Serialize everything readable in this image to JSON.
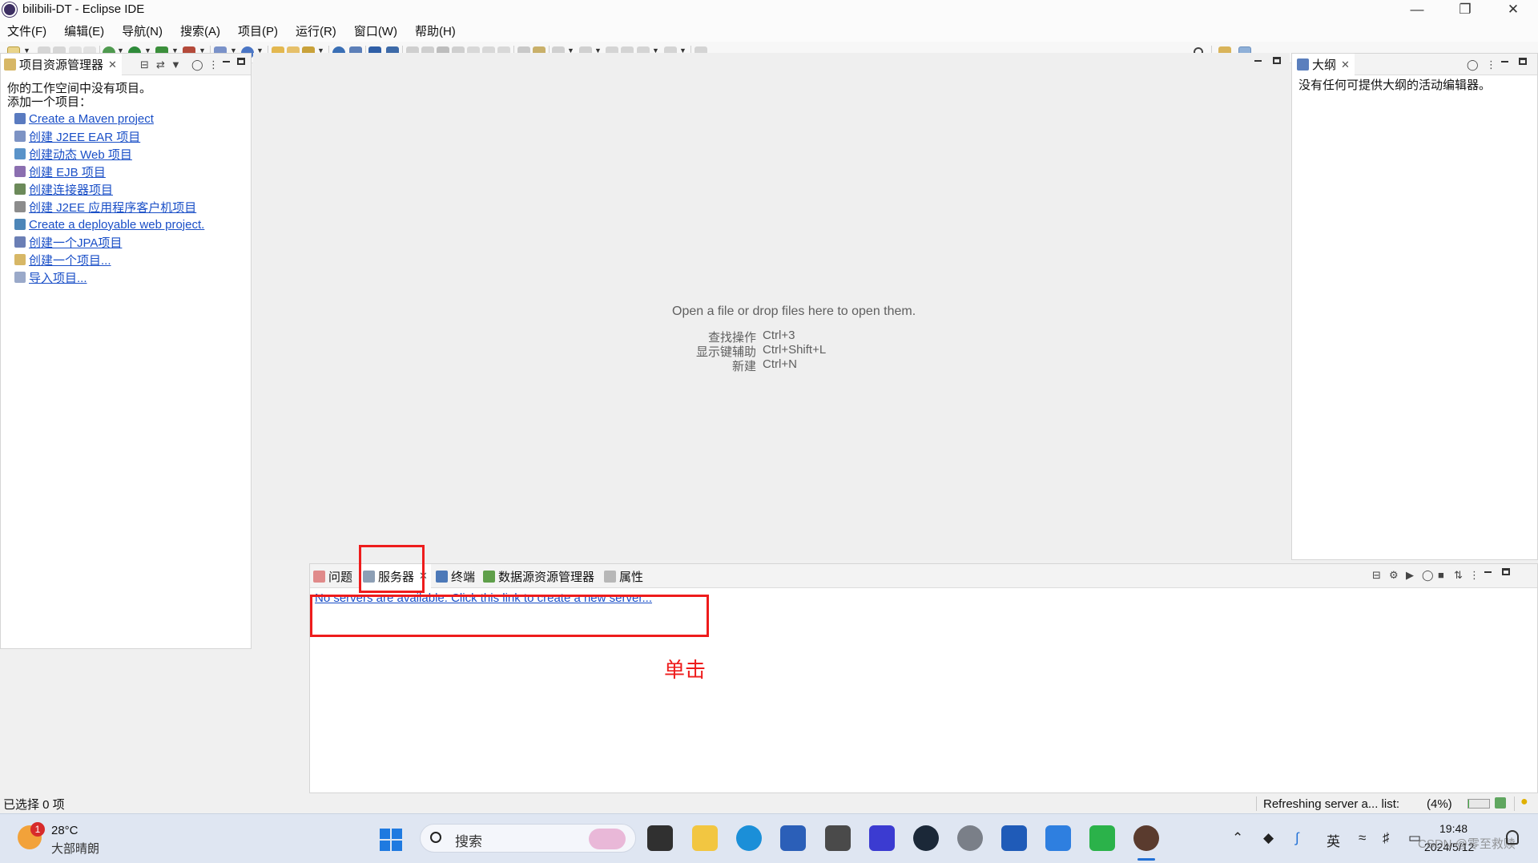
{
  "window": {
    "title": "bilibili-DT - Eclipse IDE"
  },
  "menu": [
    "文件(F)",
    "编辑(E)",
    "导航(N)",
    "搜索(A)",
    "项目(P)",
    "运行(R)",
    "窗口(W)",
    "帮助(H)"
  ],
  "project_explorer": {
    "tab_label": "项目资源管理器",
    "empty_line1": "你的工作空间中没有项目。",
    "empty_line2": "添加一个项目：",
    "links": [
      "Create a Maven project",
      "创建 J2EE EAR 项目",
      "创建动态 Web 项目",
      "创建 EJB 项目",
      "创建连接器项目",
      "创建 J2EE 应用程序客户机项目",
      "Create a deployable web project.",
      "创建一个JPA项目",
      "创建一个项目...",
      "导入项目..."
    ]
  },
  "editor": {
    "hint": "Open a file or drop files here to open them.",
    "shortcuts": [
      {
        "label": "查找操作",
        "keys": "Ctrl+3"
      },
      {
        "label": "显示键辅助",
        "keys": "Ctrl+Shift+L"
      },
      {
        "label": "新建",
        "keys": "Ctrl+N"
      }
    ]
  },
  "outline": {
    "tab_label": "大纲",
    "message": "没有任何可提供大纲的活动编辑器。"
  },
  "bottom_panel": {
    "tabs": [
      "问题",
      "服务器",
      "终端",
      "数据源资源管理器",
      "属性"
    ],
    "active_tab": "服务器",
    "server_link": "No servers are available. Click this link to create a new server...",
    "annotation": "单击"
  },
  "status": {
    "left": "已选择 0 项",
    "progress_text": "Refreshing server a... list:",
    "progress_percent": "(4%)",
    "progress_value": 0.04
  },
  "taskbar": {
    "weather_temp": "28°C",
    "weather_desc": "大部晴朗",
    "weather_badge": "1",
    "search_placeholder": "搜索",
    "ime": "英",
    "time": "19:48",
    "date": "2024/5/12",
    "watermark": "CSDN @零至救赎"
  },
  "colors": {
    "link": "#1a4fc7",
    "annotation_red": "#ee1c1c",
    "taskbar_bg": "#dfe6f2"
  }
}
